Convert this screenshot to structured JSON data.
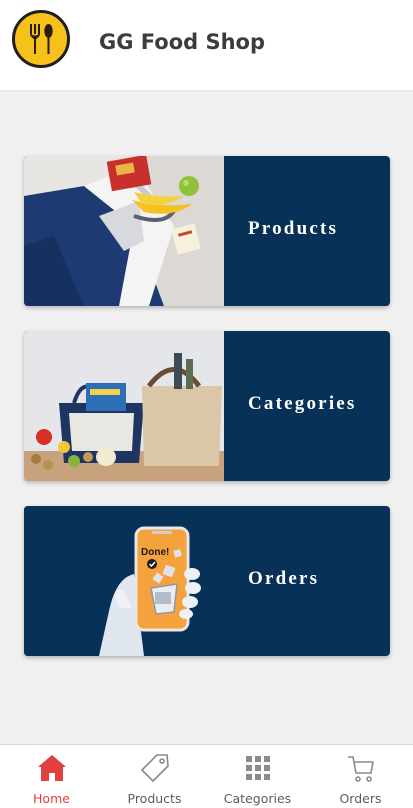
{
  "header": {
    "title": "GG Food Shop",
    "logo_icon": "fork-and-spoon-icon"
  },
  "cards": [
    {
      "label": "Products",
      "image": "grocery-tote-bag-with-bananas-image"
    },
    {
      "label": "Categories",
      "image": "shopping-bags-with-vegetables-image"
    },
    {
      "label": "Orders",
      "image": "hand-holding-phone-done-order-image"
    }
  ],
  "nav": {
    "items": [
      {
        "label": "Home",
        "icon": "home-icon",
        "active": true
      },
      {
        "label": "Products",
        "icon": "tag-icon",
        "active": false
      },
      {
        "label": "Categories",
        "icon": "grid-icon",
        "active": false
      },
      {
        "label": "Orders",
        "icon": "cart-icon",
        "active": false
      }
    ]
  },
  "phone_screen_text": "Done!",
  "colors": {
    "card_background": "#083158",
    "active_tab": "#e2403f",
    "logo_yellow": "#f5c11a",
    "page_background": "#f0f0f1"
  }
}
